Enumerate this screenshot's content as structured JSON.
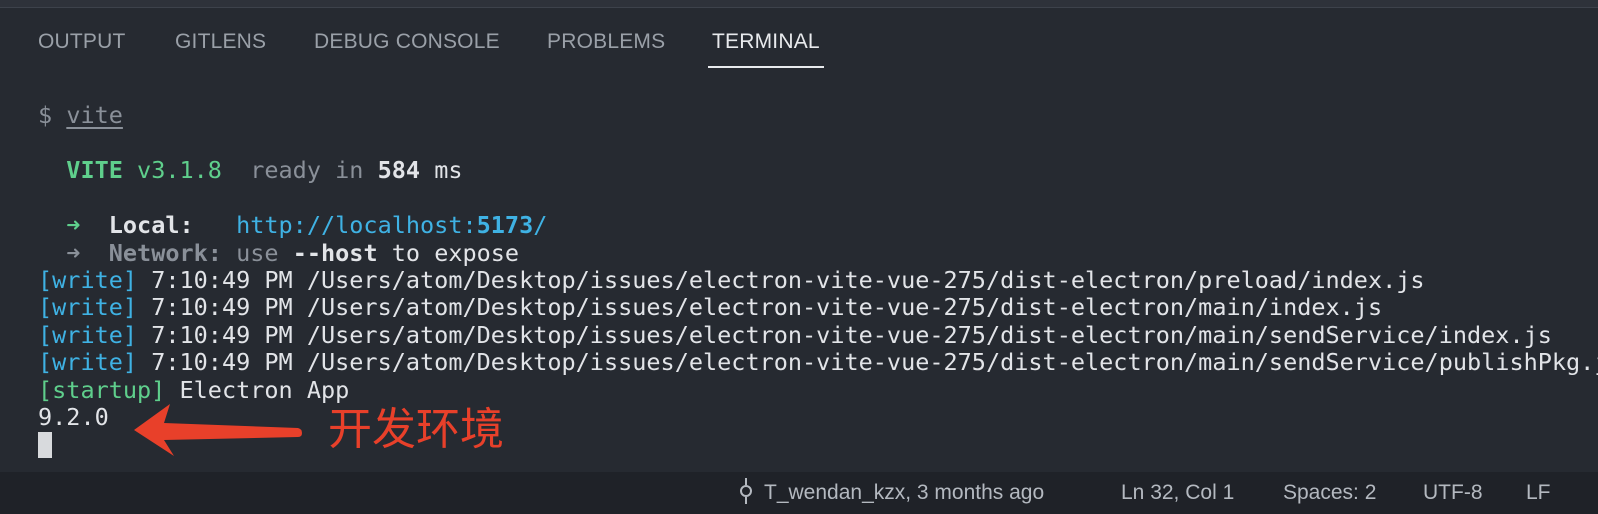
{
  "tabs": [
    {
      "label": "OUTPUT",
      "active": false
    },
    {
      "label": "GITLENS",
      "active": false
    },
    {
      "label": "DEBUG CONSOLE",
      "active": false
    },
    {
      "label": "PROBLEMS",
      "active": false
    },
    {
      "label": "TERMINAL",
      "active": true
    }
  ],
  "terminal": {
    "prompt": "$",
    "command": "vite",
    "vite": {
      "name": "VITE",
      "version": "v3.1.8",
      "ready_text": "ready in",
      "ready_ms": "584",
      "ms_unit": "ms"
    },
    "local": {
      "arrow": "➜",
      "label": "Local:",
      "url_prefix": "http://localhost:",
      "url_port": "5173",
      "url_suffix": "/"
    },
    "network": {
      "arrow": "➜",
      "label": "Network:",
      "use": "use",
      "flag": "--host",
      "rest": "to expose"
    },
    "write_lines": [
      {
        "tag": "[write]",
        "time": "7:10:49 PM",
        "path": "/Users/atom/Desktop/issues/electron-vite-vue-275/dist-electron/preload/index.js"
      },
      {
        "tag": "[write]",
        "time": "7:10:49 PM",
        "path": "/Users/atom/Desktop/issues/electron-vite-vue-275/dist-electron/main/index.js"
      },
      {
        "tag": "[write]",
        "time": "7:10:49 PM",
        "path": "/Users/atom/Desktop/issues/electron-vite-vue-275/dist-electron/main/sendService/index.js"
      },
      {
        "tag": "[write]",
        "time": "7:10:49 PM",
        "path": "/Users/atom/Desktop/issues/electron-vite-vue-275/dist-electron/main/sendService/publishPkg.js"
      }
    ],
    "startup": {
      "tag": "[startup]",
      "text": "Electron App"
    },
    "version_output": "9.2.0"
  },
  "annotation": {
    "text": "开发环境",
    "color": "#e8402a"
  },
  "status_bar": {
    "blame": "T_wendan_kzx, 3 months ago",
    "position": "Ln 32, Col 1",
    "spaces": "Spaces: 2",
    "encoding": "UTF-8",
    "eol": "LF"
  },
  "colors": {
    "background": "#262a31",
    "green": "#5fcf8c",
    "cyan": "#3fb2e4"
  }
}
